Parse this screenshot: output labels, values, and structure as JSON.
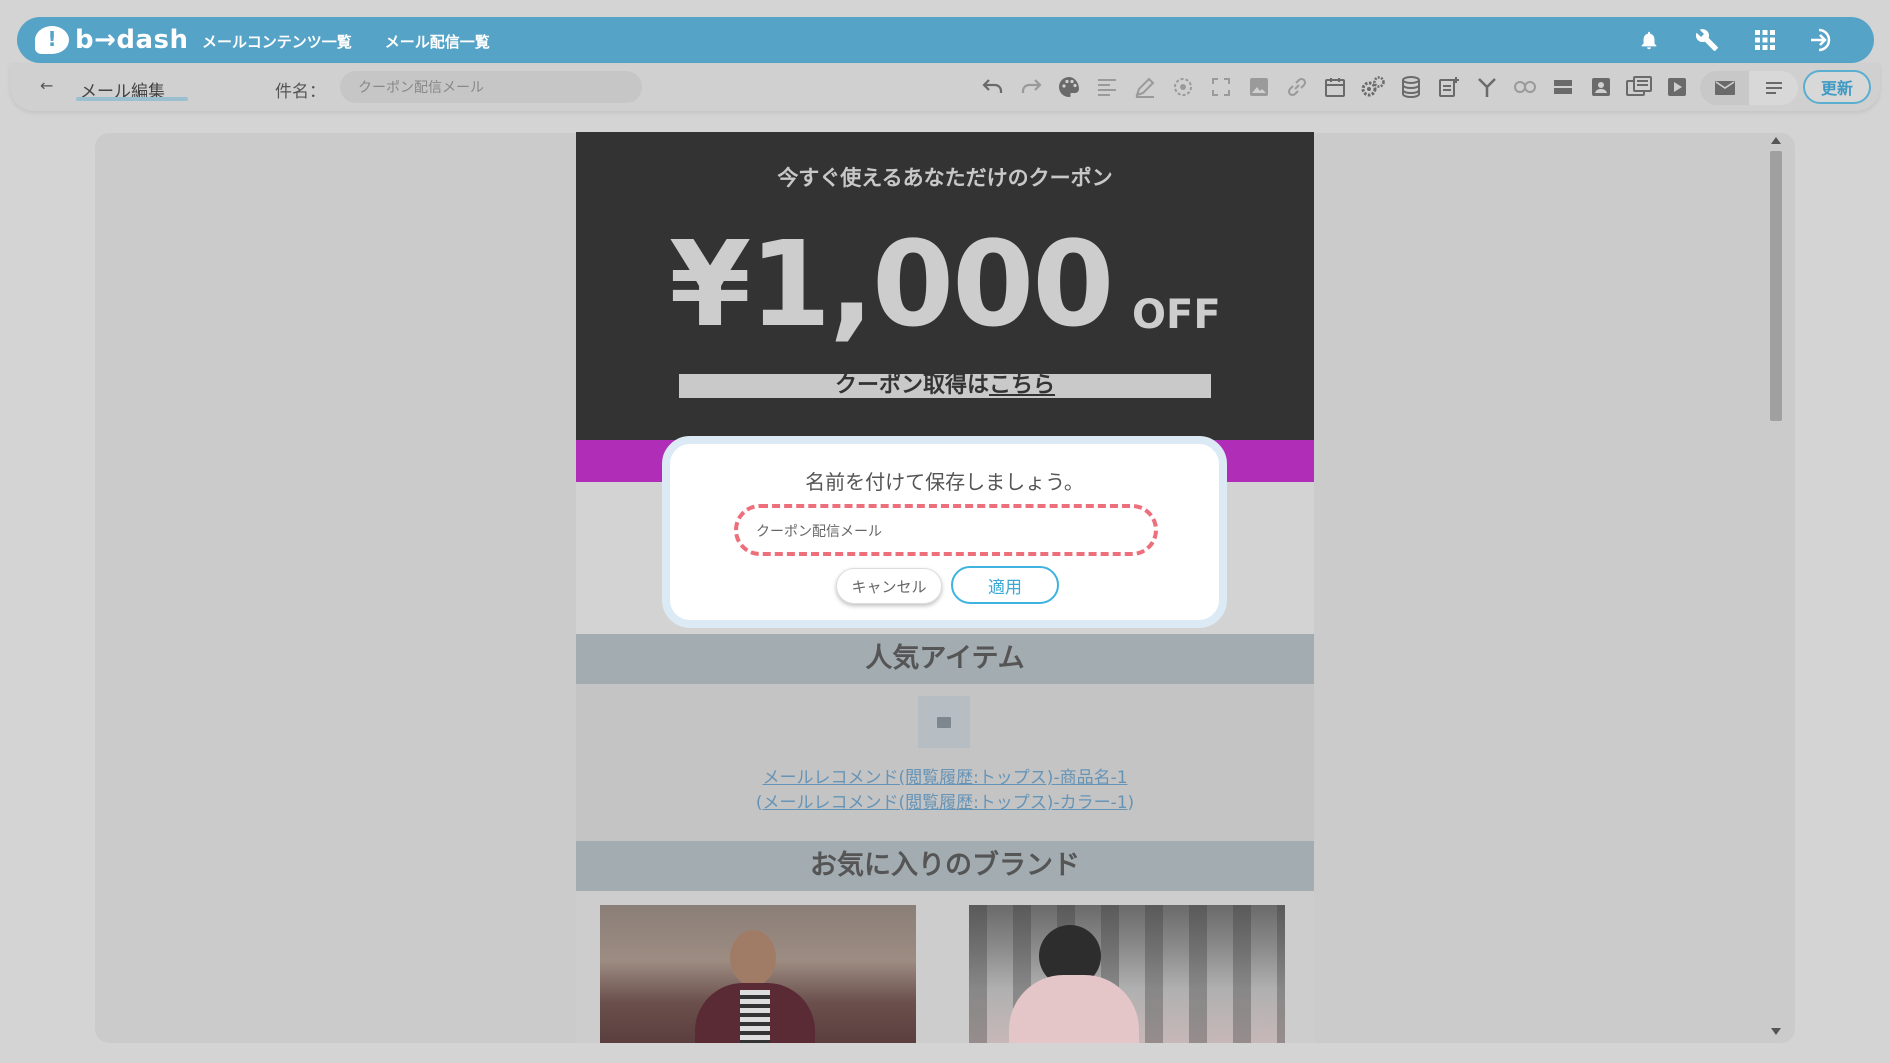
{
  "app": {
    "brand": "b→dash",
    "nav": [
      "メールコンテンツ一覧",
      "メール配信一覧"
    ],
    "top_icons": [
      "bell-icon",
      "wrench-icon",
      "grid-icon",
      "logout-icon"
    ]
  },
  "toolbar": {
    "back_label": "←",
    "title": "メール編集",
    "subject_label": "件名：",
    "subject_value": "クーポン配信メール",
    "tool_icons": [
      "undo-icon",
      "redo-icon",
      "palette-icon",
      "align-icon",
      "pen-icon",
      "target-icon",
      "fullscreen-icon",
      "image-icon",
      "link-icon",
      "calendar-icon",
      "gears-icon",
      "database-icon",
      "add-note-icon",
      "branch-icon",
      "link-chain-icon",
      "block-icon",
      "contact-icon",
      "template-icon",
      "video-icon"
    ],
    "update_label": "更新"
  },
  "email": {
    "hero_subtitle": "今すぐ使えるあなただけのクーポン",
    "hero_amount": "¥1,000",
    "hero_off": "OFF",
    "hero_cta_prefix": "クーポン取得は",
    "hero_cta_link": "こちら",
    "section_popular": "人気アイテム",
    "product_name_link": "メールレコメンド(閲覧履歴:トップス)-商品名-1",
    "product_color_link": "メールレコメンド(閲覧履歴:トップス)-カラー-1",
    "section_brand": "お気に入りのブランド"
  },
  "modal": {
    "title": "名前を付けて保存しましょう。",
    "input_value": "クーポン配信メール",
    "cancel_label": "キャンセル",
    "apply_label": "適用"
  }
}
